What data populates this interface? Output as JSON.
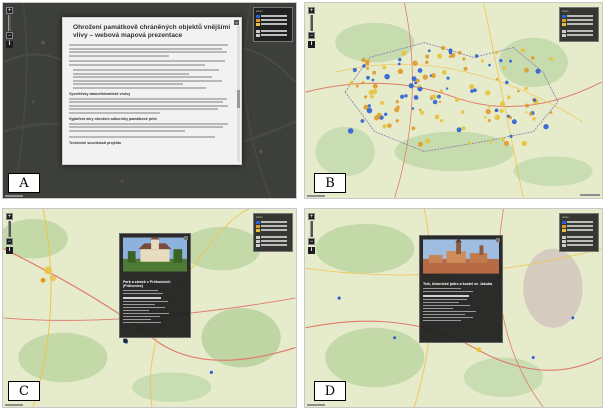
{
  "panels": [
    {
      "id": "A",
      "label": "A"
    },
    {
      "id": "B",
      "label": "B"
    },
    {
      "id": "C",
      "label": "C"
    },
    {
      "id": "D",
      "label": "D"
    }
  ],
  "dialog": {
    "title": "Ohrožení památkově chráněných objektů vnějšími vlivy – webová mapová prezentace",
    "section_1": "Vysvětlivky datové/tématické vrstvy",
    "section_2": "Vyjádření míry ohrožení odborníky památkové péče",
    "section_3": "Technické souvislosti projektu"
  },
  "popup_c": {
    "title": "Park a zámek v Průhonicích (Průhonice)"
  },
  "popup_d": {
    "title": "Telč, historické jádro a kostel sv. Jakuba"
  },
  "colors": {
    "dark_map": "#3d3f3b",
    "light_map": "#e6eccb",
    "forest": "#bcd7a6",
    "road": "#e07a6b",
    "road_yellow": "#f0c34d",
    "marker_blue": "#2a5fd6",
    "marker_orange": "#e09a2a",
    "marker_yellow": "#e7c23a"
  }
}
